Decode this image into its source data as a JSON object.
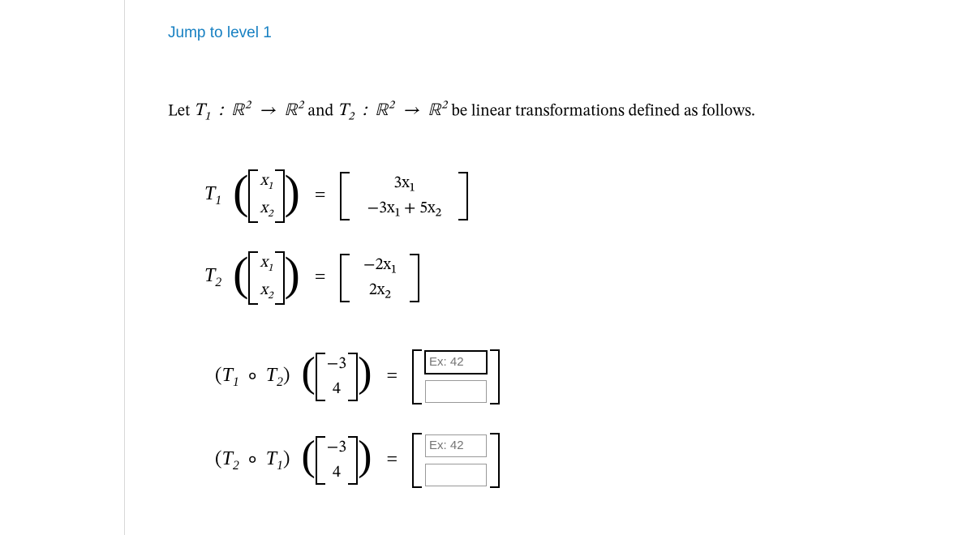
{
  "jump_link": "Jump to level 1",
  "intro_prefix": "Let ",
  "intro_middle": " and ",
  "intro_suffix": " be linear transformations defined as follows.",
  "T1_name": "T",
  "T1_sub": "1",
  "T2_name": "T",
  "T2_sub": "2",
  "R_sym": "ℝ",
  "dim": "2",
  "arrow": "→",
  "vec_x1": "x",
  "vec_x1_sub": "1",
  "vec_x2": "x",
  "vec_x2_sub": "2",
  "T1_out_top": "3x₁",
  "T1_out_bot": "−3x₁ + 5x₂",
  "T2_out_top": "−2x₁",
  "T2_out_bot": "2x₂",
  "eq_sym": "=",
  "compose_sym": "∘",
  "inp_top": "−3",
  "inp_bot": "4",
  "placeholder": "Ex: 42",
  "comp1_label_a": "T",
  "comp1_sub_a": "1",
  "comp1_label_b": "T",
  "comp1_sub_b": "2",
  "comp2_label_a": "T",
  "comp2_sub_a": "2",
  "comp2_label_b": "T",
  "comp2_sub_b": "1",
  "chart_data": {
    "type": "table",
    "note": "No chart in this screenshot; math content is data-bound above."
  }
}
